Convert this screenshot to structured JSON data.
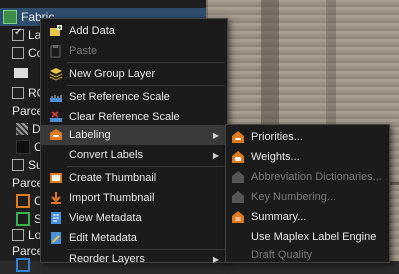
{
  "toc": {
    "rows": [
      {
        "label": "Fabric",
        "kind": "layer-selected"
      },
      {
        "label": "Labe",
        "kind": "checked"
      },
      {
        "label": "Corr",
        "kind": "unchecked"
      },
      {
        "label": "",
        "kind": "symbol"
      },
      {
        "label": "ROW",
        "kind": "unchecked"
      },
      {
        "label": "Parcel S",
        "kind": "header"
      },
      {
        "label": "De",
        "kind": "hatch"
      },
      {
        "label": "Co",
        "kind": "dark"
      },
      {
        "label": "Subd",
        "kind": "unchecked"
      },
      {
        "label": "Parcel S",
        "kind": "header"
      },
      {
        "label": "Co",
        "kind": "orange"
      },
      {
        "label": "Su",
        "kind": "green"
      },
      {
        "label": "Lots",
        "kind": "unchecked"
      },
      {
        "label": "Parcel S",
        "kind": "header"
      },
      {
        "label": "",
        "kind": "blue"
      }
    ]
  },
  "menu": {
    "items": [
      {
        "label": "Add Data",
        "icon": "add-data-icon",
        "disabled": false
      },
      {
        "label": "Paste",
        "icon": "paste-icon",
        "disabled": true
      },
      {
        "label": "New Group Layer",
        "icon": "group-layer-icon",
        "disabled": false
      },
      {
        "label": "Set Reference Scale",
        "icon": "set-scale-icon",
        "disabled": false
      },
      {
        "label": "Clear Reference Scale",
        "icon": "clear-scale-icon",
        "disabled": false
      },
      {
        "label": "Labeling",
        "icon": "labeling-icon",
        "disabled": false
      },
      {
        "label": "Convert Labels",
        "icon": "",
        "disabled": false
      },
      {
        "label": "Create Thumbnail",
        "icon": "create-thumbnail-icon",
        "disabled": false
      },
      {
        "label": "Import Thumbnail",
        "icon": "import-thumbnail-icon",
        "disabled": false
      },
      {
        "label": "View Metadata",
        "icon": "view-metadata-icon",
        "disabled": false
      },
      {
        "label": "Edit Metadata",
        "icon": "edit-metadata-icon",
        "disabled": false
      },
      {
        "label": "Reorder Layers",
        "icon": "",
        "disabled": false
      }
    ]
  },
  "submenu": {
    "items": [
      {
        "label": "Priorities...",
        "disabled": false
      },
      {
        "label": "Weights...",
        "disabled": false
      },
      {
        "label": "Abbreviation Dictionaries...",
        "disabled": true
      },
      {
        "label": "Key Numbering...",
        "disabled": true
      },
      {
        "label": "Summary...",
        "disabled": false
      },
      {
        "label": "Use Maplex Label Engine",
        "disabled": false
      },
      {
        "label": "Draft Quality",
        "disabled": true
      }
    ]
  },
  "colors": {
    "accent": "#2f4d6e",
    "highlight": "#3a3a3a",
    "orange": "#e07a1f",
    "green": "#38b24a",
    "blue": "#2f7fd6"
  }
}
